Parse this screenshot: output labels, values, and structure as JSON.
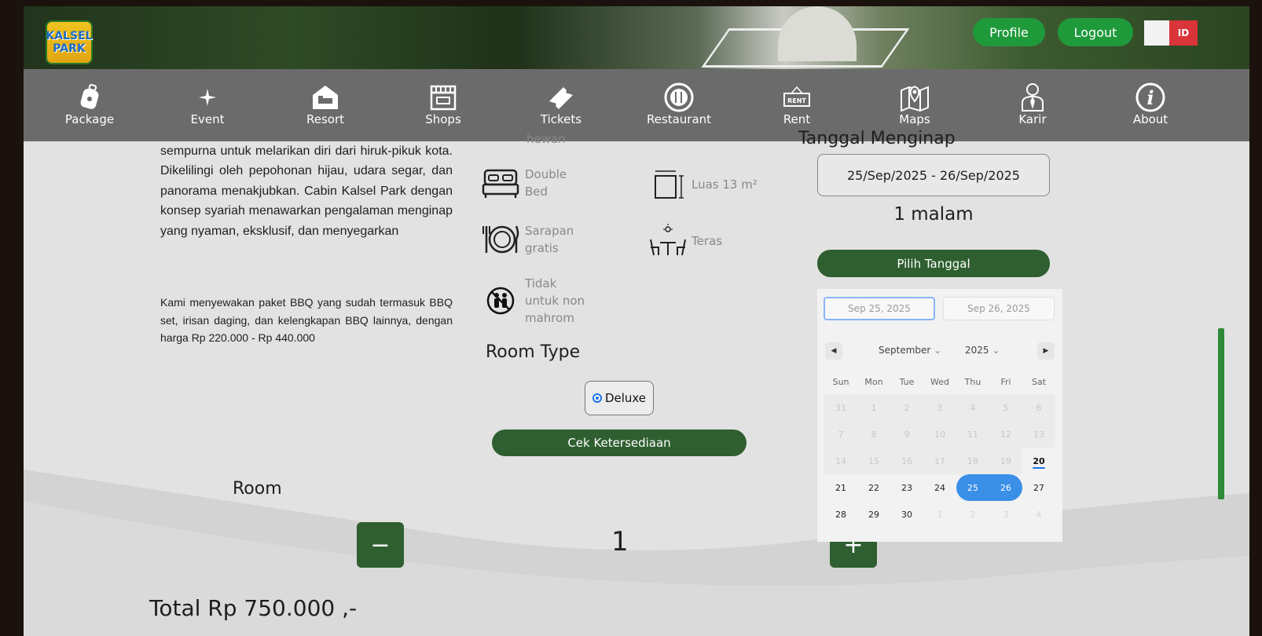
{
  "header": {
    "logo_line1": "KALSEL",
    "logo_line2": "PARK",
    "profile_label": "Profile",
    "logout_label": "Logout",
    "lang_code": "ID"
  },
  "nav": {
    "items": [
      {
        "label": "Package",
        "icon": "luggage-icon"
      },
      {
        "label": "Event",
        "icon": "sparkle-icon"
      },
      {
        "label": "Resort",
        "icon": "house-bed-icon"
      },
      {
        "label": "Shops",
        "icon": "store-icon"
      },
      {
        "label": "Tickets",
        "icon": "ticket-icon"
      },
      {
        "label": "Restaurant",
        "icon": "plate-cutlery-icon"
      },
      {
        "label": "Rent",
        "icon": "rent-sign-icon"
      },
      {
        "label": "Maps",
        "icon": "map-pin-icon"
      },
      {
        "label": "Karir",
        "icon": "person-tie-icon"
      },
      {
        "label": "About",
        "icon": "info-icon"
      }
    ]
  },
  "description": {
    "para1": "sempurna untuk melarikan diri dari hiruk-pikuk kota. Dikelilingi oleh pepohonan hijau, udara segar, dan panorama menakjubkan. Cabin Kalsel Park dengan konsep syariah menawarkan pengalaman menginap yang nyaman, eksklusif, dan menyegarkan",
    "para2": "Kami menyewakan paket BBQ yang sudah termasuk BBQ set, irisan daging, dan kelengkapan BBQ lainnya, dengan harga Rp 220.000 - Rp 440.000"
  },
  "amenities": {
    "cutoff_top": "hewan",
    "bed": "Double Bed",
    "area": "Luas 13 m²",
    "breakfast": "Sarapan gratis",
    "terrace": "Teras",
    "rule": "Tidak untuk non mahrom"
  },
  "room_type": {
    "heading": "Room Type",
    "option": "Deluxe",
    "check_button": "Cek Ketersediaan"
  },
  "room": {
    "label": "Room",
    "minus": "−",
    "plus": "+",
    "quantity": "1",
    "total": "Total Rp 750.000 ,-"
  },
  "booking": {
    "heading": "Tanggal Menginap",
    "date_range": "25/Sep/2025 - 26/Sep/2025",
    "nights": "1 malam",
    "pick_button": "Pilih Tanggal"
  },
  "calendar": {
    "from": "Sep 25, 2025",
    "to": "Sep 26, 2025",
    "month": "September",
    "year": "2025",
    "weekdays": [
      "Sun",
      "Mon",
      "Tue",
      "Wed",
      "Thu",
      "Fri",
      "Sat"
    ],
    "weeks": [
      [
        {
          "d": "31",
          "s": "dis"
        },
        {
          "d": "1",
          "s": "dis"
        },
        {
          "d": "2",
          "s": "dis"
        },
        {
          "d": "3",
          "s": "dis"
        },
        {
          "d": "4",
          "s": "dis"
        },
        {
          "d": "5",
          "s": "dis"
        },
        {
          "d": "6",
          "s": "dis"
        }
      ],
      [
        {
          "d": "7",
          "s": "dis"
        },
        {
          "d": "8",
          "s": "dis"
        },
        {
          "d": "9",
          "s": "dis"
        },
        {
          "d": "10",
          "s": "dis"
        },
        {
          "d": "11",
          "s": "dis"
        },
        {
          "d": "12",
          "s": "dis"
        },
        {
          "d": "13",
          "s": "dis"
        }
      ],
      [
        {
          "d": "14",
          "s": "dis"
        },
        {
          "d": "15",
          "s": "dis"
        },
        {
          "d": "16",
          "s": "dis"
        },
        {
          "d": "17",
          "s": "dis"
        },
        {
          "d": "18",
          "s": "dis"
        },
        {
          "d": "19",
          "s": "dis"
        },
        {
          "d": "20",
          "s": "today"
        }
      ],
      [
        {
          "d": "21",
          "s": "act"
        },
        {
          "d": "22",
          "s": "act"
        },
        {
          "d": "23",
          "s": "act"
        },
        {
          "d": "24",
          "s": "act"
        },
        {
          "d": "25",
          "s": "sel"
        },
        {
          "d": "26",
          "s": "sel"
        },
        {
          "d": "27",
          "s": "act"
        }
      ],
      [
        {
          "d": "28",
          "s": "act"
        },
        {
          "d": "29",
          "s": "act"
        },
        {
          "d": "30",
          "s": "act"
        },
        {
          "d": "1",
          "s": "nxt"
        },
        {
          "d": "2",
          "s": "nxt"
        },
        {
          "d": "3",
          "s": "nxt"
        },
        {
          "d": "4",
          "s": "nxt"
        }
      ]
    ],
    "accent_color": "#3a8fe6"
  },
  "colors": {
    "primary_green": "#2f5f30",
    "header_button_green": "#1f9a3b",
    "nav_bg": "#6b6b6b"
  }
}
